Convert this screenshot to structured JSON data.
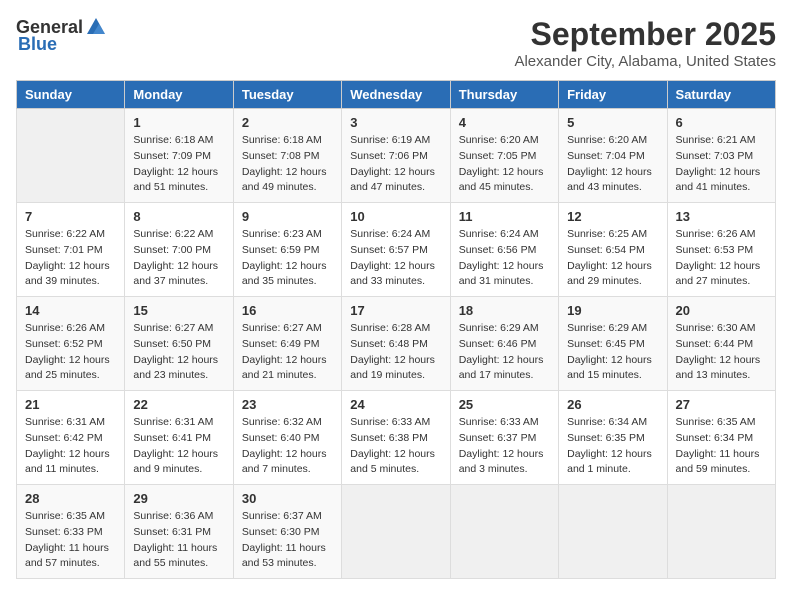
{
  "app": {
    "logo_general": "General",
    "logo_blue": "Blue"
  },
  "header": {
    "month": "September 2025",
    "location": "Alexander City, Alabama, United States"
  },
  "weekdays": [
    "Sunday",
    "Monday",
    "Tuesday",
    "Wednesday",
    "Thursday",
    "Friday",
    "Saturday"
  ],
  "weeks": [
    [
      {
        "day": "",
        "content": ""
      },
      {
        "day": "1",
        "content": "Sunrise: 6:18 AM\nSunset: 7:09 PM\nDaylight: 12 hours\nand 51 minutes."
      },
      {
        "day": "2",
        "content": "Sunrise: 6:18 AM\nSunset: 7:08 PM\nDaylight: 12 hours\nand 49 minutes."
      },
      {
        "day": "3",
        "content": "Sunrise: 6:19 AM\nSunset: 7:06 PM\nDaylight: 12 hours\nand 47 minutes."
      },
      {
        "day": "4",
        "content": "Sunrise: 6:20 AM\nSunset: 7:05 PM\nDaylight: 12 hours\nand 45 minutes."
      },
      {
        "day": "5",
        "content": "Sunrise: 6:20 AM\nSunset: 7:04 PM\nDaylight: 12 hours\nand 43 minutes."
      },
      {
        "day": "6",
        "content": "Sunrise: 6:21 AM\nSunset: 7:03 PM\nDaylight: 12 hours\nand 41 minutes."
      }
    ],
    [
      {
        "day": "7",
        "content": "Sunrise: 6:22 AM\nSunset: 7:01 PM\nDaylight: 12 hours\nand 39 minutes."
      },
      {
        "day": "8",
        "content": "Sunrise: 6:22 AM\nSunset: 7:00 PM\nDaylight: 12 hours\nand 37 minutes."
      },
      {
        "day": "9",
        "content": "Sunrise: 6:23 AM\nSunset: 6:59 PM\nDaylight: 12 hours\nand 35 minutes."
      },
      {
        "day": "10",
        "content": "Sunrise: 6:24 AM\nSunset: 6:57 PM\nDaylight: 12 hours\nand 33 minutes."
      },
      {
        "day": "11",
        "content": "Sunrise: 6:24 AM\nSunset: 6:56 PM\nDaylight: 12 hours\nand 31 minutes."
      },
      {
        "day": "12",
        "content": "Sunrise: 6:25 AM\nSunset: 6:54 PM\nDaylight: 12 hours\nand 29 minutes."
      },
      {
        "day": "13",
        "content": "Sunrise: 6:26 AM\nSunset: 6:53 PM\nDaylight: 12 hours\nand 27 minutes."
      }
    ],
    [
      {
        "day": "14",
        "content": "Sunrise: 6:26 AM\nSunset: 6:52 PM\nDaylight: 12 hours\nand 25 minutes."
      },
      {
        "day": "15",
        "content": "Sunrise: 6:27 AM\nSunset: 6:50 PM\nDaylight: 12 hours\nand 23 minutes."
      },
      {
        "day": "16",
        "content": "Sunrise: 6:27 AM\nSunset: 6:49 PM\nDaylight: 12 hours\nand 21 minutes."
      },
      {
        "day": "17",
        "content": "Sunrise: 6:28 AM\nSunset: 6:48 PM\nDaylight: 12 hours\nand 19 minutes."
      },
      {
        "day": "18",
        "content": "Sunrise: 6:29 AM\nSunset: 6:46 PM\nDaylight: 12 hours\nand 17 minutes."
      },
      {
        "day": "19",
        "content": "Sunrise: 6:29 AM\nSunset: 6:45 PM\nDaylight: 12 hours\nand 15 minutes."
      },
      {
        "day": "20",
        "content": "Sunrise: 6:30 AM\nSunset: 6:44 PM\nDaylight: 12 hours\nand 13 minutes."
      }
    ],
    [
      {
        "day": "21",
        "content": "Sunrise: 6:31 AM\nSunset: 6:42 PM\nDaylight: 12 hours\nand 11 minutes."
      },
      {
        "day": "22",
        "content": "Sunrise: 6:31 AM\nSunset: 6:41 PM\nDaylight: 12 hours\nand 9 minutes."
      },
      {
        "day": "23",
        "content": "Sunrise: 6:32 AM\nSunset: 6:40 PM\nDaylight: 12 hours\nand 7 minutes."
      },
      {
        "day": "24",
        "content": "Sunrise: 6:33 AM\nSunset: 6:38 PM\nDaylight: 12 hours\nand 5 minutes."
      },
      {
        "day": "25",
        "content": "Sunrise: 6:33 AM\nSunset: 6:37 PM\nDaylight: 12 hours\nand 3 minutes."
      },
      {
        "day": "26",
        "content": "Sunrise: 6:34 AM\nSunset: 6:35 PM\nDaylight: 12 hours\nand 1 minute."
      },
      {
        "day": "27",
        "content": "Sunrise: 6:35 AM\nSunset: 6:34 PM\nDaylight: 11 hours\nand 59 minutes."
      }
    ],
    [
      {
        "day": "28",
        "content": "Sunrise: 6:35 AM\nSunset: 6:33 PM\nDaylight: 11 hours\nand 57 minutes."
      },
      {
        "day": "29",
        "content": "Sunrise: 6:36 AM\nSunset: 6:31 PM\nDaylight: 11 hours\nand 55 minutes."
      },
      {
        "day": "30",
        "content": "Sunrise: 6:37 AM\nSunset: 6:30 PM\nDaylight: 11 hours\nand 53 minutes."
      },
      {
        "day": "",
        "content": ""
      },
      {
        "day": "",
        "content": ""
      },
      {
        "day": "",
        "content": ""
      },
      {
        "day": "",
        "content": ""
      }
    ]
  ]
}
